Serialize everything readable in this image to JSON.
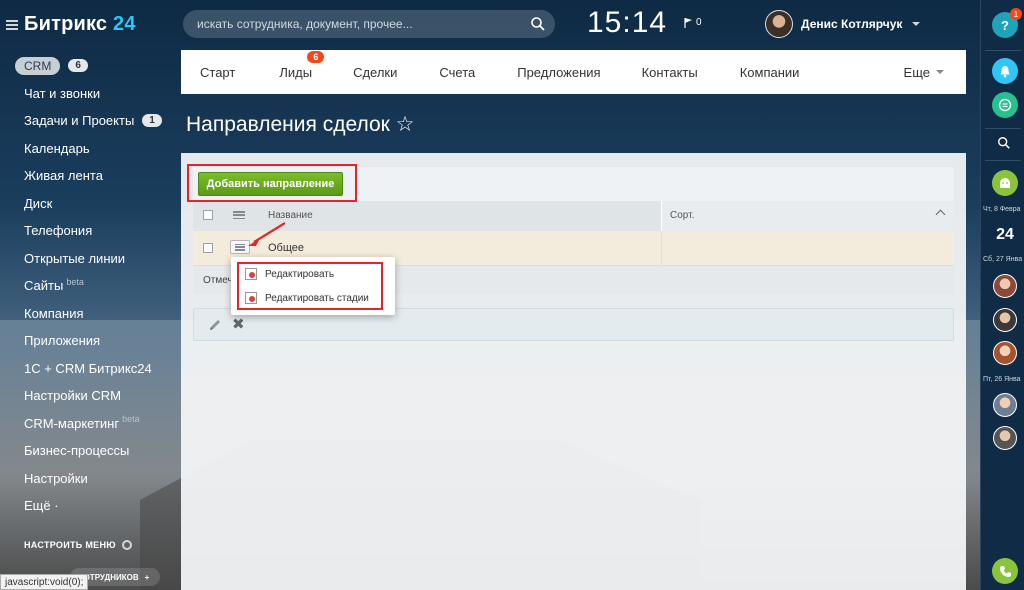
{
  "app": {
    "logo_main": "Битрикс",
    "logo_num": "24"
  },
  "header": {
    "search_placeholder": "искать сотрудника, документ, прочее...",
    "clock": "15:14",
    "flag_count": "0",
    "user_name": "Денис Котлярчук"
  },
  "sidebar": {
    "items": [
      {
        "label": "CRM",
        "count": "6"
      },
      {
        "label": "Чат и звонки"
      },
      {
        "label": "Задачи и Проекты",
        "count": "1"
      },
      {
        "label": "Календарь"
      },
      {
        "label": "Живая лента"
      },
      {
        "label": "Диск"
      },
      {
        "label": "Телефония"
      },
      {
        "label": "Открытые линии"
      },
      {
        "label": "Сайты",
        "sup": "beta"
      },
      {
        "label": "Компания"
      },
      {
        "label": "Приложения"
      },
      {
        "label": "1С + CRM Битрикс24"
      },
      {
        "label": "Настройки CRM"
      },
      {
        "label": "CRM-маркетинг",
        "sup": "beta"
      },
      {
        "label": "Бизнес-процессы"
      },
      {
        "label": "Настройки"
      },
      {
        "label": "Ещё ·"
      }
    ],
    "tune_menu": "НАСТРОИТЬ МЕНЮ",
    "invite_label": "СОТРУДНИКОВ",
    "invite_plus": "+",
    "status_tip": "javascript:void(0);"
  },
  "topnav": {
    "tabs": [
      "Старт",
      "Лиды",
      "Сделки",
      "Счета",
      "Предложения",
      "Контакты",
      "Компании"
    ],
    "lead_badge": "6",
    "more": "Еще"
  },
  "page": {
    "title": "Направления сделок ☆"
  },
  "grid": {
    "add_button": "Добавить направление",
    "col_name": "Название",
    "col_sort": "Сорт.",
    "rows": [
      {
        "name": "Общее"
      }
    ],
    "footer": "Отмеч"
  },
  "popup": {
    "items": [
      "Редактировать",
      "Редактировать стадии"
    ]
  },
  "rightbar": {
    "help": "?",
    "help_badge": "1",
    "counter_24": "24",
    "dates": [
      "Чт, 8 Февра",
      "Сб, 27 Янва",
      "Пт, 26 Янва"
    ]
  },
  "colors": {
    "accent_blue": "#2fc6f6",
    "badge_red": "#f54819",
    "button_green": "#6aab20",
    "highlight_red": "#e0262a"
  }
}
